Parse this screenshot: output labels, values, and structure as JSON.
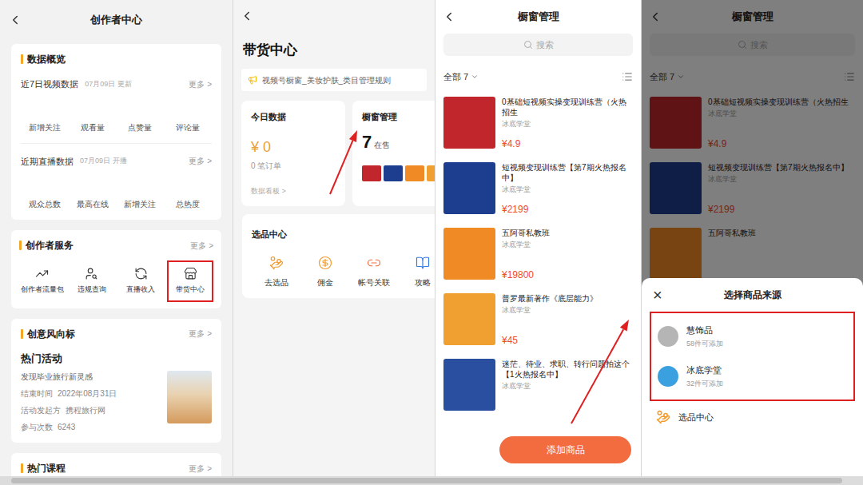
{
  "creator_center": {
    "title": "创作者中心",
    "overview": {
      "title": "数据概览",
      "sections": [
        {
          "label": "近7日视频数据",
          "date": "07月09日 更新",
          "more": "更多 >",
          "stats": [
            "新增关注",
            "观看量",
            "点赞量",
            "评论量"
          ]
        },
        {
          "label": "近期直播数据",
          "date": "07月09日 开播",
          "more": "更多 >",
          "stats": [
            "观众总数",
            "最高在线",
            "新增关注",
            "总热度"
          ]
        }
      ]
    },
    "services": {
      "title": "创作者服务",
      "more": "更多 >",
      "items": [
        {
          "label": "创作者流量包",
          "highlighted": false
        },
        {
          "label": "违规查询",
          "highlighted": false
        },
        {
          "label": "直播收入",
          "highlighted": false
        },
        {
          "label": "带货中心",
          "highlighted": true
        }
      ]
    },
    "trends": {
      "title": "创意风向标",
      "more": "更多 >",
      "heading": "热门活动",
      "name": "发现毕业旅行新灵感",
      "details": [
        {
          "label": "结束时间",
          "value": "2022年08月31日"
        },
        {
          "label": "活动发起方",
          "value": "携程旅行网"
        },
        {
          "label": "参与次数",
          "value": "6243"
        }
      ]
    },
    "courses": {
      "title": "热门课程",
      "more": "更多 >"
    }
  },
  "sales_center": {
    "title": "带货中心",
    "notice": "视频号橱窗_美妆护肤_类目管理规则",
    "today": {
      "title": "今日数据",
      "amount": "¥ 0",
      "orders": "0 笔订单",
      "link": "数据看板 >"
    },
    "showcase": {
      "title": "橱窗管理",
      "count": "7",
      "status": "在售",
      "thumbs": [
        "#c0262b",
        "#1d3d8f",
        "#f08a24",
        "#f0a030"
      ]
    },
    "selection": {
      "title": "选品中心",
      "items": [
        "去选品",
        "佣金",
        "帐号关联",
        "攻略"
      ]
    }
  },
  "showcase_manager": {
    "title": "橱窗管理",
    "search": "搜索",
    "filter": "全部 7",
    "products": [
      {
        "title": "0基础短视频实操变现训练营（火热招生",
        "store": "冰底学堂",
        "price": "¥4.9",
        "color": "#c0262b"
      },
      {
        "title": "短视频变现训练营【第7期火热报名中】",
        "store": "冰底学堂",
        "price": "¥2199",
        "color": "#1d3d8f"
      },
      {
        "title": "五阿哥私教班",
        "store": "冰底学堂",
        "price": "¥19800",
        "color": "#f08a24"
      },
      {
        "title": "普罗最新著作《底层能力》",
        "store": "冰底学堂",
        "price": "¥45",
        "color": "#f0a030"
      },
      {
        "title": "迷茫、待业、求职、转行问题拍这个【1火热报名中】",
        "store": "冰底学堂",
        "price": "",
        "color": "#2a4fa0"
      }
    ],
    "add_button": "添加商品"
  },
  "source_sheet": {
    "underlay": {
      "title": "橱窗管理",
      "search": "搜索",
      "filter": "全部 7",
      "products": [
        {
          "title": "0基础短视频实操变现训练营（火热招生",
          "store": "冰底学堂",
          "price": "¥4.9",
          "color": "#c0262b"
        },
        {
          "title": "短视频变现训练营【第7期火热报名中】",
          "store": "冰底学堂",
          "price": "¥2199",
          "color": "#1d3d8f"
        },
        {
          "title": "五阿哥私教班",
          "store": "",
          "price": "",
          "color": "#f08a24"
        }
      ]
    },
    "close": "×",
    "title": "选择商品来源",
    "highlighted": true,
    "sources": [
      {
        "name": "慧饰品",
        "count": "58件可添加",
        "color": "#b5b5b5"
      },
      {
        "name": "冰底学堂",
        "count": "32件可添加",
        "color": "#3aa0e0"
      }
    ],
    "extra": {
      "label": "选品中心"
    }
  }
}
